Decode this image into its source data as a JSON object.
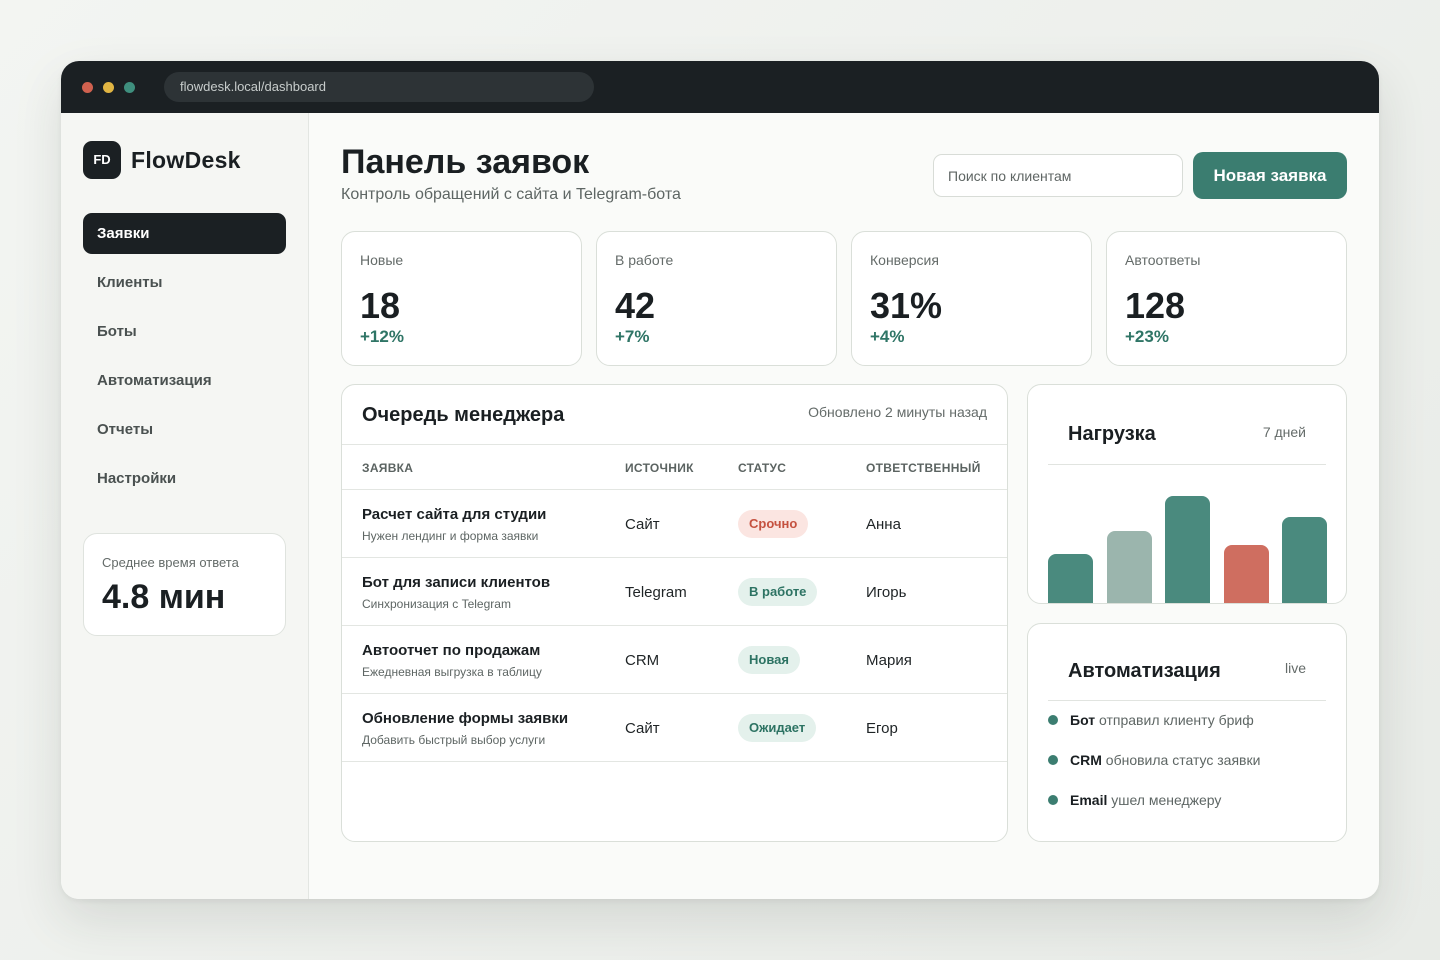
{
  "browser": {
    "url": "flowdesk.local/dashboard"
  },
  "sidebar": {
    "logo_mark": "FD",
    "logo_text": "FlowDesk",
    "items": [
      {
        "label": "Заявки",
        "active": true
      },
      {
        "label": "Клиенты",
        "active": false
      },
      {
        "label": "Боты",
        "active": false
      },
      {
        "label": "Автоматизация",
        "active": false
      },
      {
        "label": "Отчеты",
        "active": false
      },
      {
        "label": "Настройки",
        "active": false
      }
    ],
    "avg_card": {
      "label": "Среднее время ответа",
      "value": "4.8 мин"
    }
  },
  "header": {
    "title": "Панель заявок",
    "subtitle": "Контроль обращений с сайта и Telegram-бота",
    "search_placeholder": "Поиск по клиентам",
    "new_button": "Новая заявка"
  },
  "stats": [
    {
      "label": "Новые",
      "value": "18",
      "delta": "+12%"
    },
    {
      "label": "В работе",
      "value": "42",
      "delta": "+7%"
    },
    {
      "label": "Конверсия",
      "value": "31%",
      "delta": "+4%"
    },
    {
      "label": "Автоответы",
      "value": "128",
      "delta": "+23%"
    }
  ],
  "queue": {
    "title": "Очередь менеджера",
    "updated": "Обновлено 2 минуты назад",
    "columns": [
      "ЗАЯВКА",
      "ИСТОЧНИК",
      "СТАТУС",
      "ОТВЕТСТВЕННЫЙ"
    ],
    "rows": [
      {
        "title": "Расчет сайта для студии",
        "desc": "Нужен лендинг и форма заявки",
        "source": "Сайт",
        "status": "Срочно",
        "owner": "Анна"
      },
      {
        "title": "Бот для записи клиентов",
        "desc": "Синхронизация с Telegram",
        "source": "Telegram",
        "status": "В работе",
        "owner": "Игорь"
      },
      {
        "title": "Автоотчет по продажам",
        "desc": "Ежедневная выгрузка в таблицу",
        "source": "CRM",
        "status": "Новая",
        "owner": "Мария"
      },
      {
        "title": "Обновление формы заявки",
        "desc": "Добавить быстрый выбор услуги",
        "source": "Сайт",
        "status": "Ожидает",
        "owner": "Егор"
      }
    ]
  },
  "load": {
    "title": "Нагрузка",
    "period": "7 дней",
    "bars": [
      {
        "value": 0.5,
        "color": "#4a8a7e"
      },
      {
        "value": 0.7,
        "color": "#9bb5ad"
      },
      {
        "value": 1.0,
        "color": "#4a8a7e"
      },
      {
        "value": 0.58,
        "color": "#cf6e60"
      },
      {
        "value": 0.82,
        "color": "#4a8a7e"
      }
    ]
  },
  "automation": {
    "title": "Автоматизация",
    "badge": "live",
    "events": [
      {
        "actor": "Бот",
        "text": "отправил клиенту бриф"
      },
      {
        "actor": "CRM",
        "text": "обновила статус заявки"
      },
      {
        "actor": "Email",
        "text": "ушел менеджеру"
      }
    ]
  },
  "colors": {
    "accent": "#3b7d70",
    "dark": "#1b2023",
    "urgent": "#c5513f"
  }
}
